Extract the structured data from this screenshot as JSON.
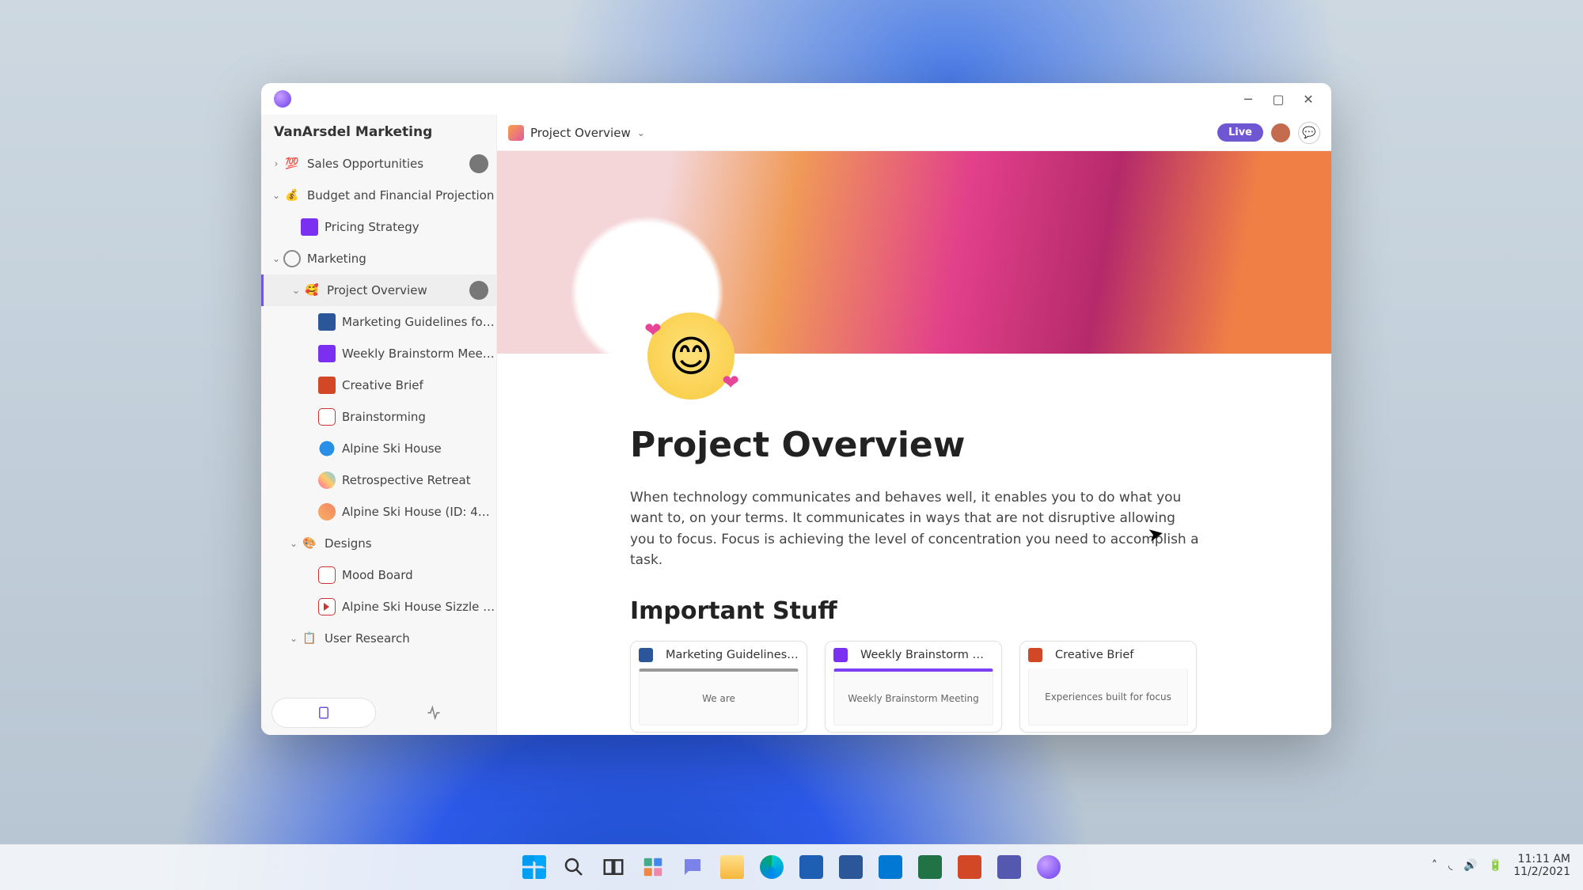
{
  "sidebar": {
    "title": "VanArsdel Marketing",
    "items": [
      {
        "label": "Sales Opportunities",
        "icon": "💯",
        "chev": "right",
        "avatar": true,
        "depth": 0
      },
      {
        "label": "Budget and Financial Projection",
        "icon": "💰",
        "chev": "down",
        "depth": 0
      },
      {
        "label": "Pricing Strategy",
        "iconClass": "i-note",
        "depth": 1
      },
      {
        "label": "Marketing",
        "iconClass": "i-circ",
        "chev": "down",
        "depth": 0
      },
      {
        "label": "Project Overview",
        "icon": "🥰",
        "chev": "down",
        "avatar": true,
        "active": true,
        "depth": 1
      },
      {
        "label": "Marketing Guidelines for V…",
        "iconClass": "i-word",
        "depth": 2
      },
      {
        "label": "Weekly Brainstorm Meeting",
        "iconClass": "i-note",
        "depth": 2
      },
      {
        "label": "Creative Brief",
        "iconClass": "i-ppt",
        "depth": 2
      },
      {
        "label": "Brainstorming",
        "iconClass": "i-wb",
        "depth": 2
      },
      {
        "label": "Alpine Ski House",
        "iconClass": "i-web",
        "depth": 2
      },
      {
        "label": "Retrospective Retreat",
        "iconClass": "i-pal",
        "depth": 2
      },
      {
        "label": "Alpine Ski House (ID: 487…",
        "iconClass": "i-av",
        "depth": 2
      },
      {
        "label": "Designs",
        "icon": "🎨",
        "chev": "down",
        "depth": 1
      },
      {
        "label": "Mood Board",
        "iconClass": "i-wb",
        "depth": 2
      },
      {
        "label": "Alpine Ski House Sizzle Re…",
        "iconClass": "i-vid",
        "depth": 2
      },
      {
        "label": "User Research",
        "icon": "📋",
        "chev": "down",
        "depth": 1
      }
    ]
  },
  "header": {
    "crumb": "Project Overview",
    "live": "Live"
  },
  "page": {
    "title": "Project Overview",
    "body": "When technology communicates and behaves well, it enables you to do what you want to, on your terms. It communicates in ways that are not disruptive allowing you to focus. Focus is achieving the level of concentration you need to accomplish a task.",
    "section": "Important Stuff",
    "cards": [
      {
        "title": "Marketing Guidelines f…",
        "iconClass": "i-word",
        "preview": "We are"
      },
      {
        "title": "Weekly Brainstorm Me…",
        "iconClass": "i-note",
        "preview": "Weekly Brainstorm Meeting"
      },
      {
        "title": "Creative Brief",
        "iconClass": "i-ppt",
        "preview": "Experiences built for focus"
      }
    ]
  },
  "tray": {
    "time": "11:11 AM",
    "date": "11/2/2021"
  }
}
